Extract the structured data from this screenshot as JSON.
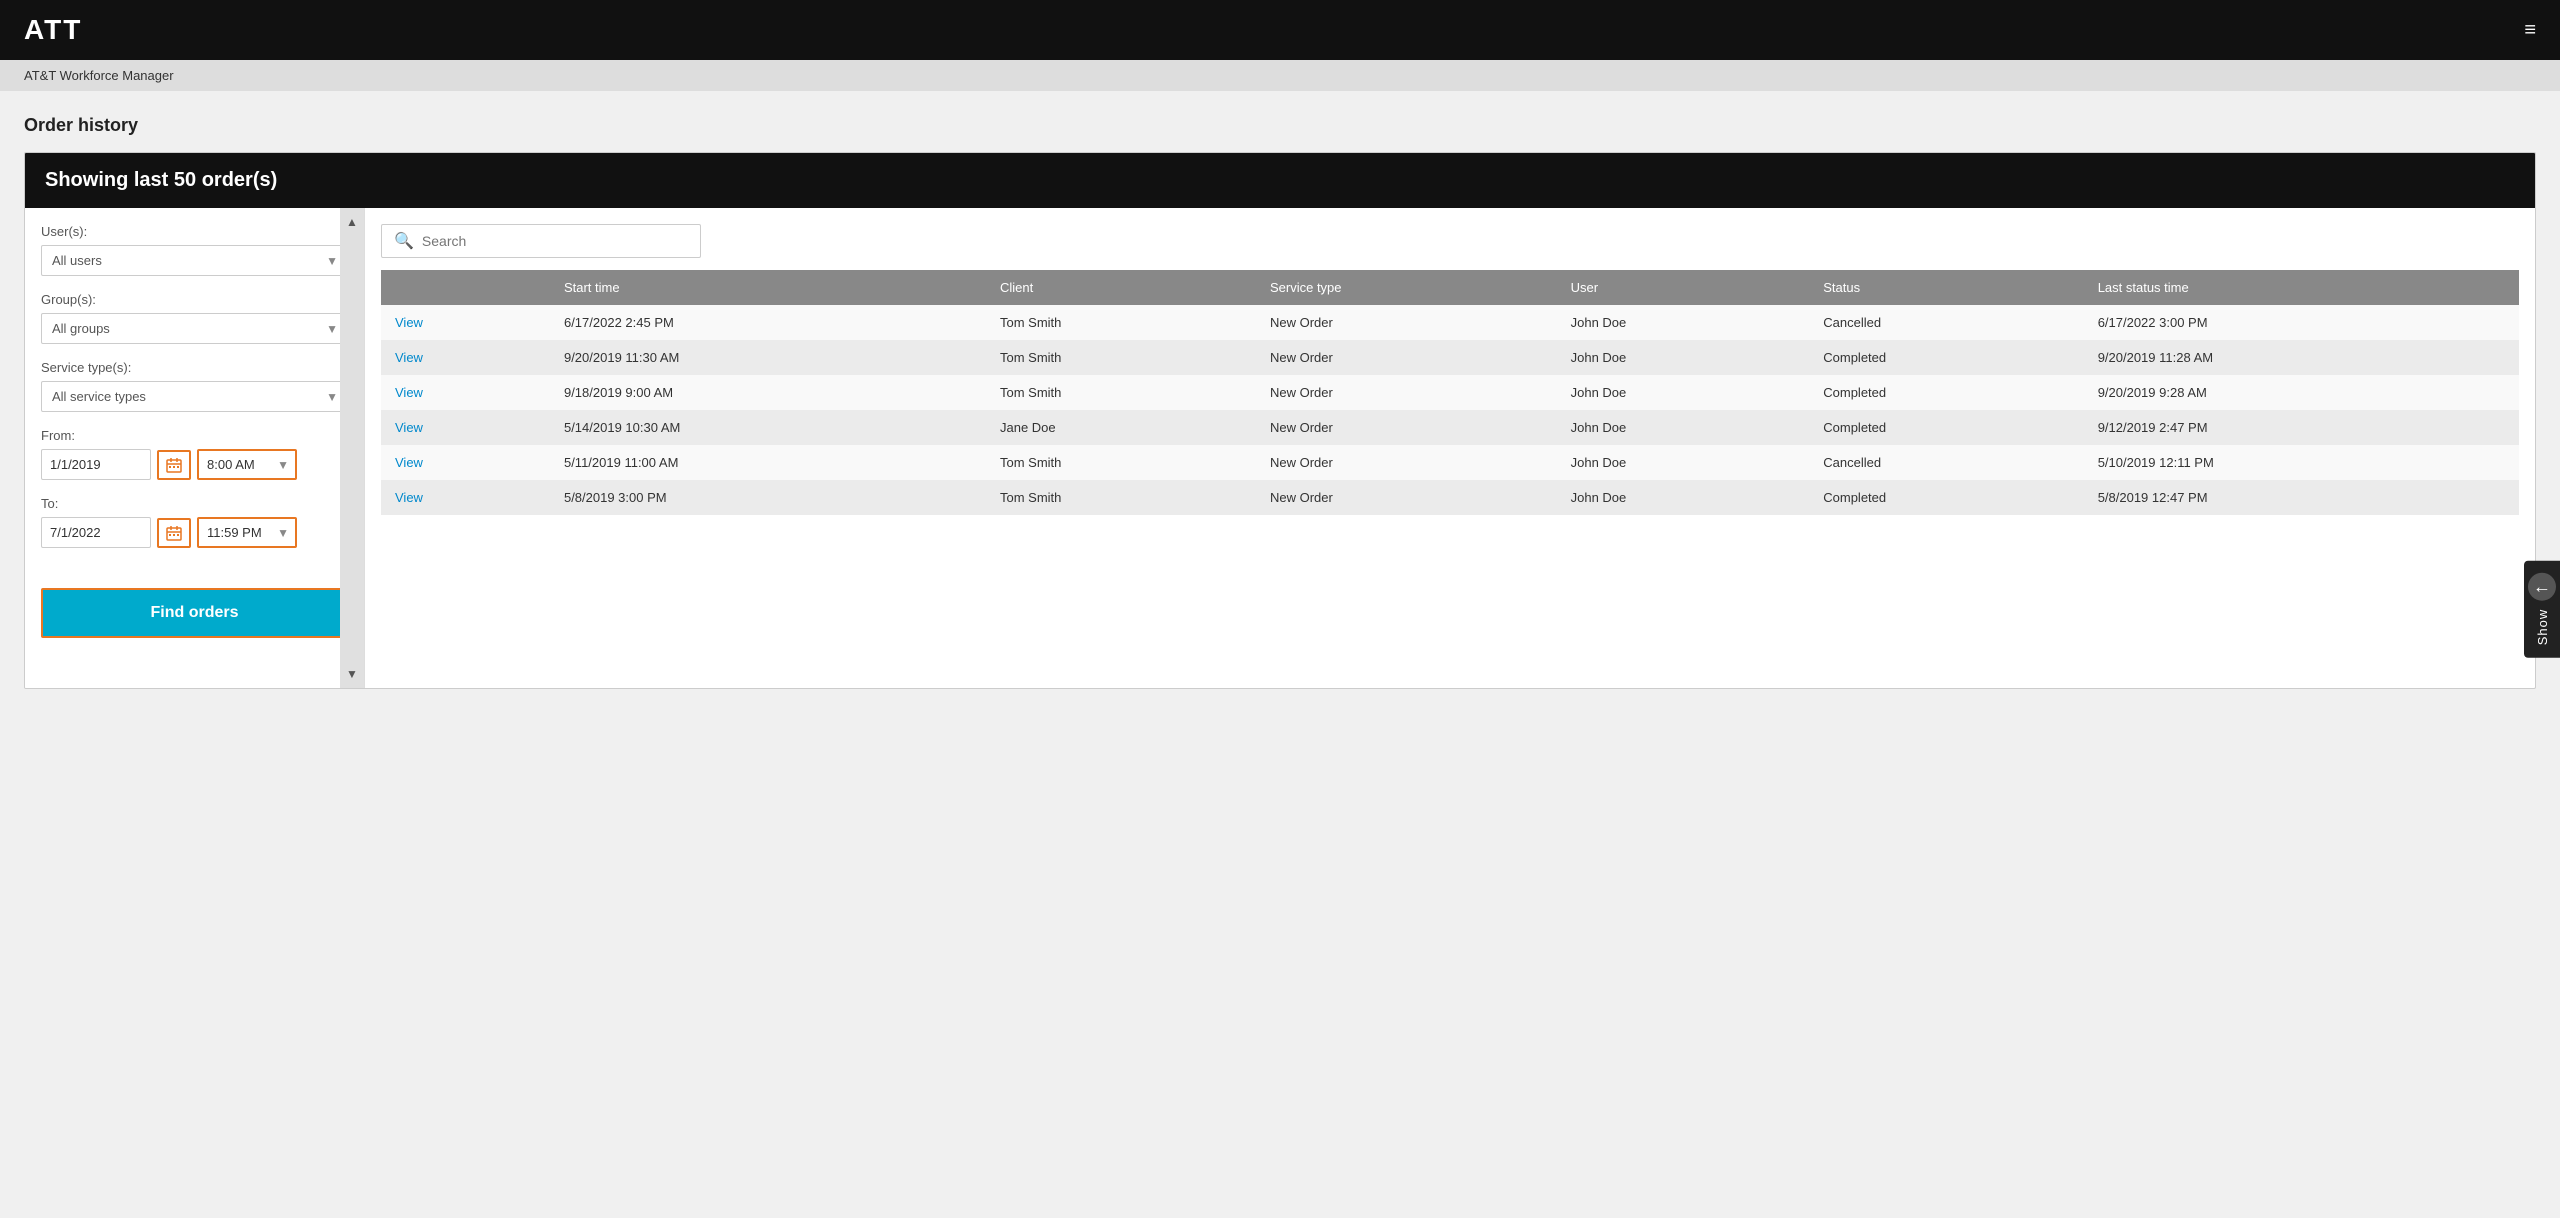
{
  "nav": {
    "logo": "ATT",
    "menu_icon": "≡",
    "subtitle": "AT&T Workforce Manager"
  },
  "page": {
    "title": "Order history",
    "card_header": "Showing last 50 order(s)"
  },
  "filters": {
    "users_label": "User(s):",
    "users_value": "All users",
    "groups_label": "Group(s):",
    "groups_value": "All groups",
    "service_type_label": "Service type(s):",
    "service_type_value": "All service types",
    "from_label": "From:",
    "from_date": "1/1/2019",
    "from_time": "8:00 AM",
    "to_label": "To:",
    "to_date": "7/1/2022",
    "to_time": "11:59 PM",
    "find_orders_label": "Find orders"
  },
  "search": {
    "placeholder": "Search"
  },
  "table": {
    "columns": [
      "",
      "Start time",
      "Client",
      "Service type",
      "User",
      "Status",
      "Last status time"
    ],
    "rows": [
      {
        "link": "View",
        "start_time": "6/17/2022 2:45 PM",
        "client": "Tom Smith",
        "service_type": "New Order",
        "user": "John Doe",
        "status": "Cancelled",
        "last_status_time": "6/17/2022 3:00 PM"
      },
      {
        "link": "View",
        "start_time": "9/20/2019 11:30 AM",
        "client": "Tom Smith",
        "service_type": "New Order",
        "user": "John Doe",
        "status": "Completed",
        "last_status_time": "9/20/2019 11:28 AM"
      },
      {
        "link": "View",
        "start_time": "9/18/2019 9:00 AM",
        "client": "Tom Smith",
        "service_type": "New Order",
        "user": "John Doe",
        "status": "Completed",
        "last_status_time": "9/20/2019 9:28 AM"
      },
      {
        "link": "View",
        "start_time": "5/14/2019 10:30 AM",
        "client": "Jane Doe",
        "service_type": "New Order",
        "user": "John Doe",
        "status": "Completed",
        "last_status_time": "9/12/2019 2:47 PM"
      },
      {
        "link": "View",
        "start_time": "5/11/2019 11:00 AM",
        "client": "Tom Smith",
        "service_type": "New Order",
        "user": "John Doe",
        "status": "Cancelled",
        "last_status_time": "5/10/2019 12:11 PM"
      },
      {
        "link": "View",
        "start_time": "5/8/2019 3:00 PM",
        "client": "Tom Smith",
        "service_type": "New Order",
        "user": "John Doe",
        "status": "Completed",
        "last_status_time": "5/8/2019 12:47 PM"
      }
    ]
  },
  "show_panel": {
    "arrow": "←",
    "label": "Show"
  }
}
